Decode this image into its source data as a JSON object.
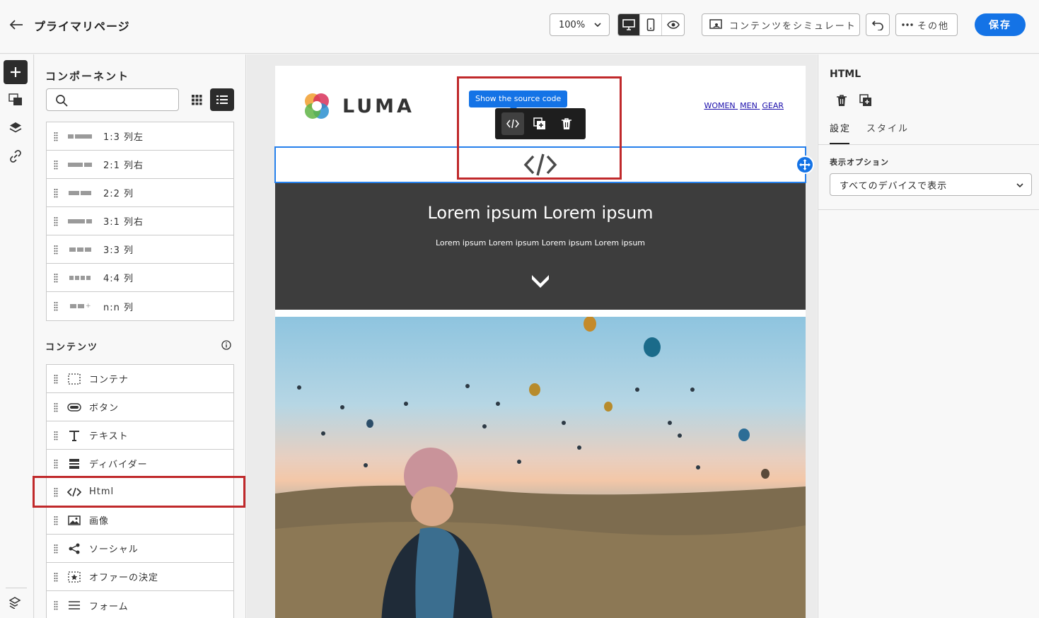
{
  "header": {
    "title": "プライマリページ",
    "zoom": "100%",
    "simulate_label": "コンテンツをシミュレート",
    "more_label": "その他",
    "save_label": "保存"
  },
  "components_panel": {
    "title": "コンポーネント",
    "search_placeholder": "",
    "structures": [
      {
        "label": "1:3 列左"
      },
      {
        "label": "2:1 列右"
      },
      {
        "label": "2:2 列"
      },
      {
        "label": "3:1 列右"
      },
      {
        "label": "3:3 列"
      },
      {
        "label": "4:4 列"
      },
      {
        "label": "n:n 列"
      }
    ],
    "content_title": "コンテンツ",
    "content_items": [
      {
        "label": "コンテナ",
        "icon": "container-icon"
      },
      {
        "label": "ボタン",
        "icon": "button-icon"
      },
      {
        "label": "テキスト",
        "icon": "text-icon"
      },
      {
        "label": "ディバイダー",
        "icon": "divider-icon"
      },
      {
        "label": "Html",
        "icon": "code-icon"
      },
      {
        "label": "画像",
        "icon": "image-icon"
      },
      {
        "label": "ソーシャル",
        "icon": "share-icon"
      },
      {
        "label": "オファーの決定",
        "icon": "offer-icon"
      },
      {
        "label": "フォーム",
        "icon": "form-icon"
      }
    ]
  },
  "email": {
    "brand": "LUMA",
    "nav": [
      "WOMEN",
      "MEN",
      "GEAR"
    ],
    "tooltip": "Show the source code",
    "hero_title": "Lorem ipsum Lorem ipsum",
    "hero_subtitle": "Lorem ipsum Lorem ipsum Lorem ipsum Lorem ipsum"
  },
  "properties": {
    "title": "HTML",
    "tabs": [
      "設定",
      "スタイル"
    ],
    "display_label": "表示オプション",
    "display_value": "すべてのデバイスで表示"
  },
  "colors": {
    "accent": "#1473e6",
    "highlight": "#c0292b",
    "hero_bg": "#3d3d3d"
  }
}
